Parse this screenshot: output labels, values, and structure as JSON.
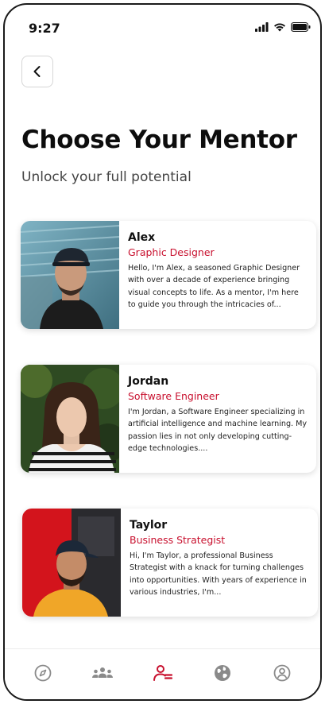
{
  "status": {
    "time": "9:27"
  },
  "header": {
    "title": "Choose Your Mentor",
    "subtitle": "Unlock your full potential"
  },
  "mentors": [
    {
      "name": "Alex",
      "role": "Graphic Designer",
      "description": "Hello, I'm Alex, a seasoned Graphic Designer with over a decade of experience bringing visual concepts to life. As a mentor, I'm here to guide you through the intricacies of..."
    },
    {
      "name": "Jordan",
      "role": "Software Engineer",
      "description": "I'm Jordan, a Software Engineer specializing in artificial intelligence and machine learning. My passion lies in not only developing cutting-edge technologies...."
    },
    {
      "name": "Taylor",
      "role": "Business Strategist",
      "description": "Hi, I'm Taylor, a professional Business Strategist with a knack for turning challenges into opportunities. With years of experience in various industries, I'm..."
    }
  ],
  "tabs": [
    {
      "icon": "compass-icon",
      "active": false
    },
    {
      "icon": "community-icon",
      "active": false
    },
    {
      "icon": "mentor-icon",
      "active": true
    },
    {
      "icon": "globe-icon",
      "active": false
    },
    {
      "icon": "profile-icon",
      "active": false
    }
  ],
  "colors": {
    "accent": "#c8102e",
    "inactive_icon": "#8a8a8a"
  }
}
